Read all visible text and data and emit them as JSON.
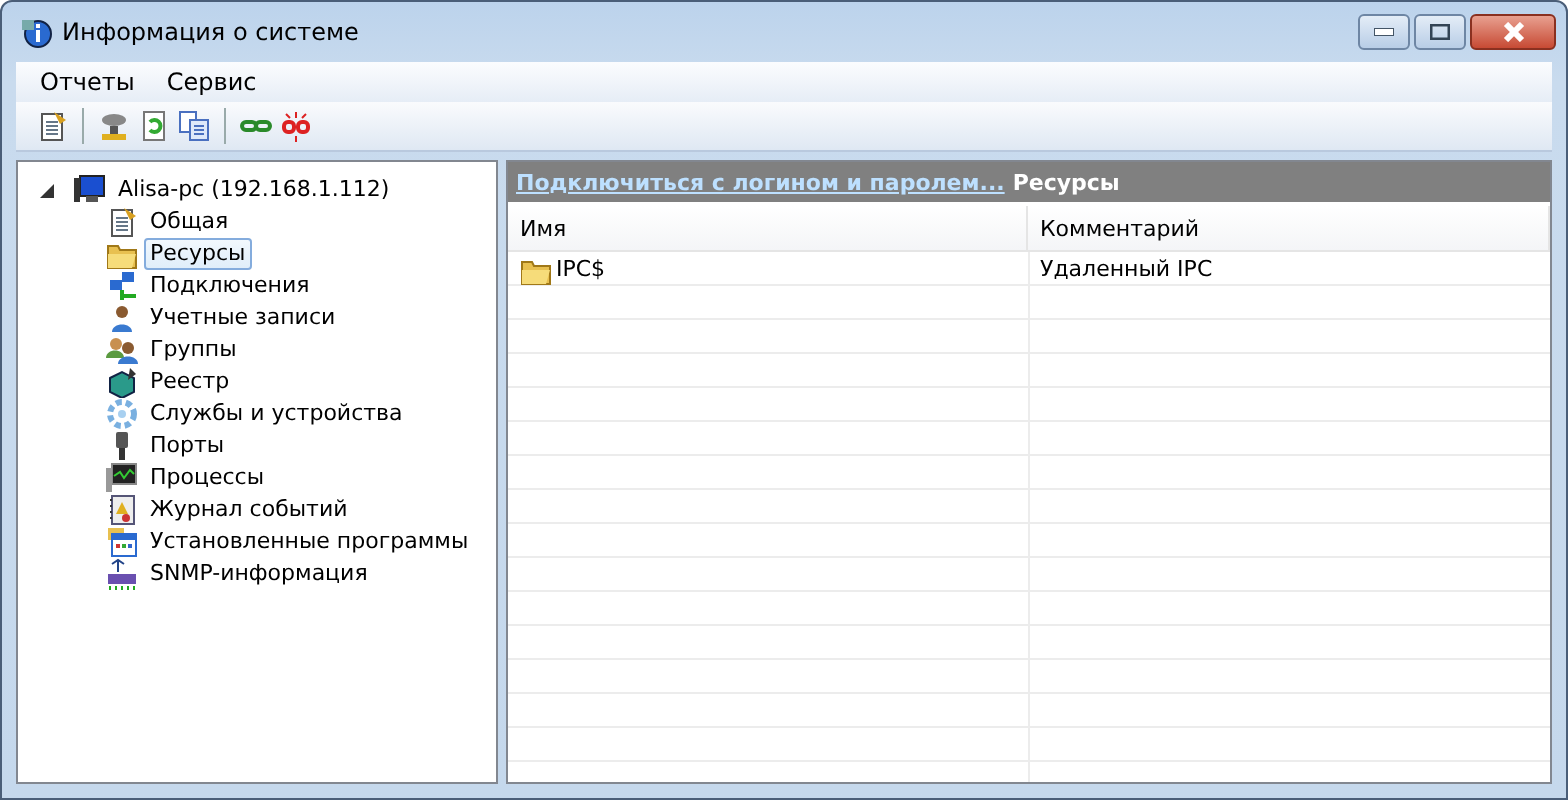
{
  "window": {
    "title": "Информация о системе"
  },
  "menu": [
    "Отчеты",
    "Сервис"
  ],
  "tree": {
    "label": "Alisa-pc (192.168.1.112)",
    "expanded": true,
    "children": [
      {
        "label": "Общая",
        "selected": false
      },
      {
        "label": "Ресурсы",
        "selected": true
      },
      {
        "label": "Подключения",
        "selected": false
      },
      {
        "label": "Учетные записи",
        "selected": false
      },
      {
        "label": "Группы",
        "selected": false
      },
      {
        "label": "Реестр",
        "selected": false
      },
      {
        "label": "Службы и устройства",
        "selected": false
      },
      {
        "label": "Порты",
        "selected": false
      },
      {
        "label": "Процессы",
        "selected": false
      },
      {
        "label": "Журнал событий",
        "selected": false
      },
      {
        "label": "Установленные программы",
        "selected": false
      },
      {
        "label": "SNMP-информация",
        "selected": false
      }
    ]
  },
  "panel": {
    "link": "Подключиться с логином и паролем...",
    "title": "Ресурсы"
  },
  "table": {
    "columns": [
      "Имя",
      "Комментарий"
    ],
    "rows": [
      {
        "name": "IPC$",
        "comment": "Удаленный IPC"
      }
    ]
  }
}
